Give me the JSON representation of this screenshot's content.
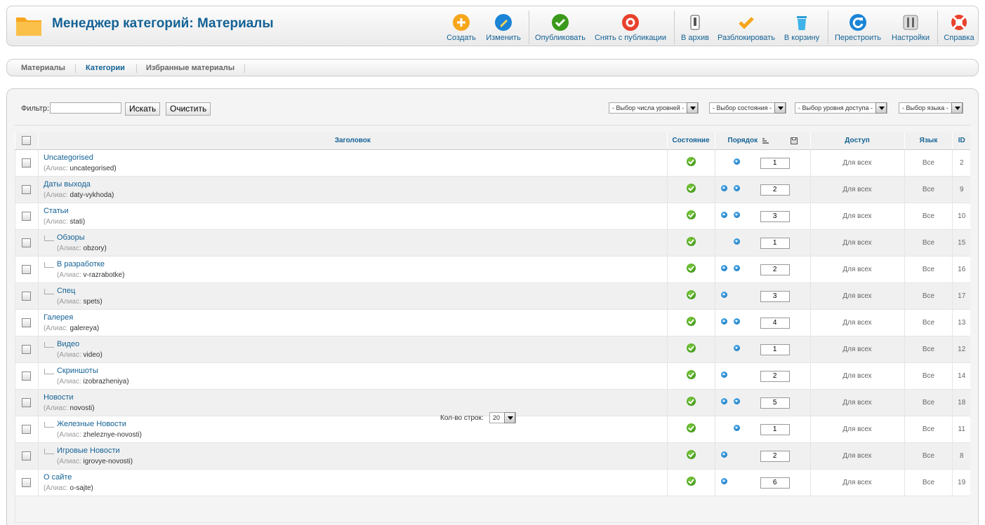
{
  "header": {
    "title": "Менеджер категорий: Материалы",
    "buttons": [
      {
        "label": "Создать",
        "icon": "plus-icon"
      },
      {
        "label": "Изменить",
        "icon": "pencil-icon"
      },
      {
        "label": "Опубликовать",
        "icon": "check-icon"
      },
      {
        "label": "Снять с публикации",
        "icon": "unpublish-icon"
      },
      {
        "label": "В архив",
        "icon": "archive-icon"
      },
      {
        "label": "Разблокировать",
        "icon": "checkin-icon"
      },
      {
        "label": "В корзину",
        "icon": "trash-icon"
      },
      {
        "label": "Перестроить",
        "icon": "refresh-icon"
      },
      {
        "label": "Настройки",
        "icon": "settings-icon"
      },
      {
        "label": "Справка",
        "icon": "help-icon"
      }
    ],
    "colors": {
      "accent": "#146295",
      "plus": "#f7a61c",
      "publish": "#3b9a1b",
      "unpublish": "#e8412c",
      "refresh": "#1a84d6"
    }
  },
  "submenu": {
    "items": [
      {
        "label": "Материалы",
        "active": false
      },
      {
        "label": "Категории",
        "active": true
      },
      {
        "label": "Избранные материалы",
        "active": false
      }
    ]
  },
  "filter": {
    "label": "Фильтр:",
    "value": "",
    "search_button": "Искать",
    "clear_button": "Очистить",
    "selects": [
      "- Выбор числа уровней -",
      "- Выбор состояния -",
      "- Выбор уровня доступа -",
      "- Выбор языка -"
    ]
  },
  "table": {
    "columns": {
      "title": "Заголовок",
      "state": "Состояние",
      "order": "Порядок",
      "access": "Доступ",
      "language": "Язык",
      "id": "ID"
    },
    "alias_label": "(Алиас:",
    "rows": [
      {
        "title": "Uncategorised",
        "alias": "uncategorised)",
        "level": 1,
        "up": false,
        "down": true,
        "order": "1",
        "access": "Для всех",
        "language": "Все",
        "id": "2"
      },
      {
        "title": "Даты выхода",
        "alias": "daty-vykhoda)",
        "level": 1,
        "up": true,
        "down": true,
        "order": "2",
        "access": "Для всех",
        "language": "Все",
        "id": "9"
      },
      {
        "title": "Статьи",
        "alias": "stati)",
        "level": 1,
        "up": true,
        "down": true,
        "order": "3",
        "access": "Для всех",
        "language": "Все",
        "id": "10"
      },
      {
        "title": "Обзоры",
        "alias": "obzory)",
        "level": 2,
        "up": false,
        "down": true,
        "order": "1",
        "access": "Для всех",
        "language": "Все",
        "id": "15"
      },
      {
        "title": "В разработке",
        "alias": "v-razrabotke)",
        "level": 2,
        "up": true,
        "down": true,
        "order": "2",
        "access": "Для всех",
        "language": "Все",
        "id": "16"
      },
      {
        "title": "Спец",
        "alias": "spets)",
        "level": 2,
        "up": true,
        "down": false,
        "order": "3",
        "access": "Для всех",
        "language": "Все",
        "id": "17"
      },
      {
        "title": "Галерея",
        "alias": "galereya)",
        "level": 1,
        "up": true,
        "down": true,
        "order": "4",
        "access": "Для всех",
        "language": "Все",
        "id": "13"
      },
      {
        "title": "Видео",
        "alias": "video)",
        "level": 2,
        "up": false,
        "down": true,
        "order": "1",
        "access": "Для всех",
        "language": "Все",
        "id": "12"
      },
      {
        "title": "Скриншоты",
        "alias": "izobrazheniya)",
        "level": 2,
        "up": true,
        "down": false,
        "order": "2",
        "access": "Для всех",
        "language": "Все",
        "id": "14"
      },
      {
        "title": "Новости",
        "alias": "novosti)",
        "level": 1,
        "up": true,
        "down": true,
        "order": "5",
        "access": "Для всех",
        "language": "Все",
        "id": "18"
      },
      {
        "title": "Железные Новости",
        "alias": "zheleznye-novosti)",
        "level": 2,
        "up": false,
        "down": true,
        "order": "1",
        "access": "Для всех",
        "language": "Все",
        "id": "11"
      },
      {
        "title": "Игровые Новости",
        "alias": "igrovye-novosti)",
        "level": 2,
        "up": true,
        "down": false,
        "order": "2",
        "access": "Для всех",
        "language": "Все",
        "id": "8"
      },
      {
        "title": "О сайте",
        "alias": "o-sajte)",
        "level": 1,
        "up": true,
        "down": false,
        "order": "6",
        "access": "Для всех",
        "language": "Все",
        "id": "19"
      }
    ]
  },
  "pagination": {
    "rows_label": "Кол-во строк:",
    "rows_value": "20"
  }
}
